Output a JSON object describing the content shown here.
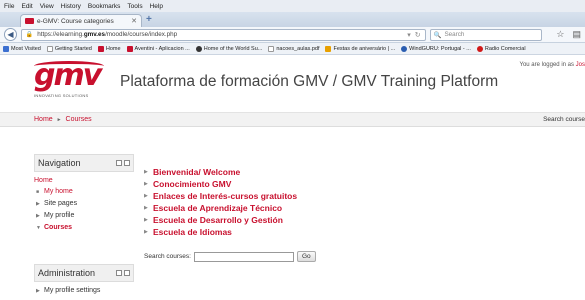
{
  "browser": {
    "menu": [
      "File",
      "Edit",
      "View",
      "History",
      "Bookmarks",
      "Tools",
      "Help"
    ],
    "tab_title": "e-GMV: Course categories",
    "url_prefix": "https://elearning.",
    "url_domain": "gmv.es",
    "url_path": "/moodle/course/index.php",
    "search_placeholder": "Search",
    "bookmarks": [
      {
        "label": "Most Visited",
        "icon": "star-icon",
        "color": "#3b6fd0"
      },
      {
        "label": "Getting Started",
        "icon": "page-icon",
        "color": "#ffffff"
      },
      {
        "label": "Home",
        "icon": "gmv-icon",
        "color": "#c8102e"
      },
      {
        "label": "Aventini - Aplicacion ...",
        "icon": "gmv-icon",
        "color": "#c8102e"
      },
      {
        "label": "Home of the World Su...",
        "icon": "globe-icon",
        "color": "#333333"
      },
      {
        "label": "nacoes_aulas.pdf",
        "icon": "page-icon",
        "color": "#ffffff"
      },
      {
        "label": "Festas de aniversário | ...",
        "icon": "star-icon",
        "color": "#e8a000"
      },
      {
        "label": "WindGURU: Portugal - ...",
        "icon": "wind-icon",
        "color": "#2a5db0"
      },
      {
        "label": "Radio Comercial",
        "icon": "radio-icon",
        "color": "#d01818"
      }
    ]
  },
  "header": {
    "logo_text": "gmv",
    "logo_tagline": "INNOVATING SOLUTIONS",
    "site_title": "Plataforma de formación GMV / GMV Training Platform",
    "login_prefix": "You are logged in as ",
    "login_user": "Jos"
  },
  "breadcrumb": {
    "home": "Home",
    "separator": "►",
    "current": "Courses",
    "search_courses": "Search course"
  },
  "navigation": {
    "title": "Navigation",
    "home": "Home",
    "items": [
      "My home",
      "Site pages",
      "My profile",
      "Courses"
    ]
  },
  "administration": {
    "title": "Administration",
    "items": [
      "My profile settings"
    ]
  },
  "categories": [
    "Bienvenida/ Welcome",
    "Conocimiento GMV",
    "Enlaces de Interés-cursos gratuitos",
    "Escuela de Aprendizaje Técnico",
    "Escuela de Desarrollo y Gestión",
    "Escuela de Idiomas"
  ],
  "search": {
    "label": "Search courses:",
    "button": "Go"
  },
  "colors": {
    "accent": "#c8102e"
  }
}
